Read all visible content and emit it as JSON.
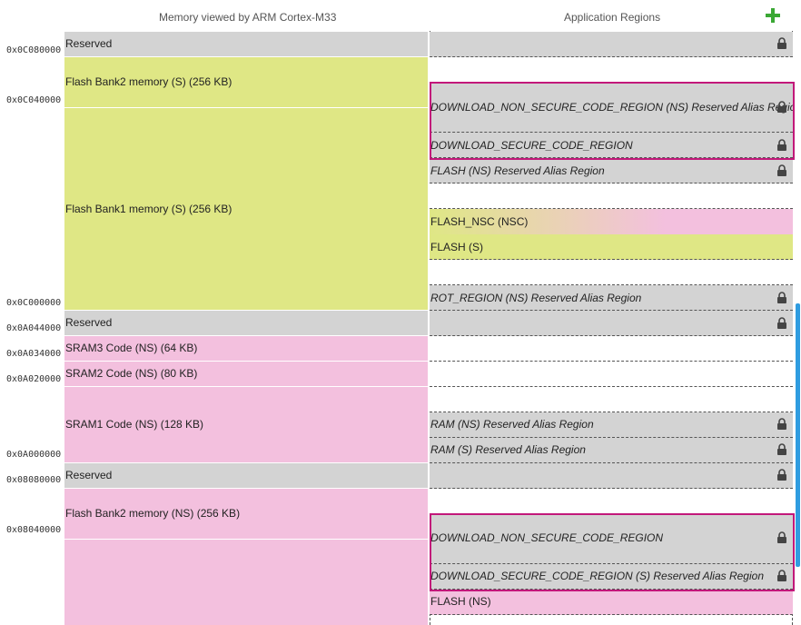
{
  "headers": {
    "left": "Memory viewed by ARM Cortex-M33",
    "right": "Application Regions"
  },
  "colors": {
    "accent_add": "#3aa834",
    "highlight_border": "#c2187a",
    "secure_green": "#dfe785",
    "nonsecure_pink": "#f3c0de",
    "reserved_gray": "#d3d3d3",
    "scrollbar": "#2f9ce0"
  },
  "addresses": [
    "0x0C080000",
    "0x0C040000",
    "0x0C000000",
    "0x0A044000",
    "0x0A034000",
    "0x0A020000",
    "0x0A000000",
    "0x08080000",
    "0x08040000"
  ],
  "memory": [
    "Reserved",
    "Flash Bank2 memory (S) (256 KB)",
    "Flash Bank1 memory (S) (256 KB)",
    "Reserved",
    "SRAM3 Code (NS) (64 KB)",
    "SRAM2 Code (NS) (80 KB)",
    "SRAM1 Code (NS) (128 KB)",
    "Reserved",
    "Flash Bank2 memory (NS) (256 KB)"
  ],
  "regions": [
    "",
    "",
    "DOWNLOAD_NON_SECURE_CODE_REGION (NS) Reserved Alias Region",
    "DOWNLOAD_SECURE_CODE_REGION",
    "FLASH (NS) Reserved Alias Region",
    "",
    "FLASH_NSC (NSC)",
    "FLASH (S)",
    "",
    "ROT_REGION (NS) Reserved Alias Region",
    "",
    "",
    "",
    "",
    "RAM (NS) Reserved Alias Region",
    "RAM (S) Reserved Alias Region",
    "",
    "",
    "DOWNLOAD_NON_SECURE_CODE_REGION",
    "DOWNLOAD_SECURE_CODE_REGION (S) Reserved Alias Region",
    "FLASH (NS)"
  ]
}
